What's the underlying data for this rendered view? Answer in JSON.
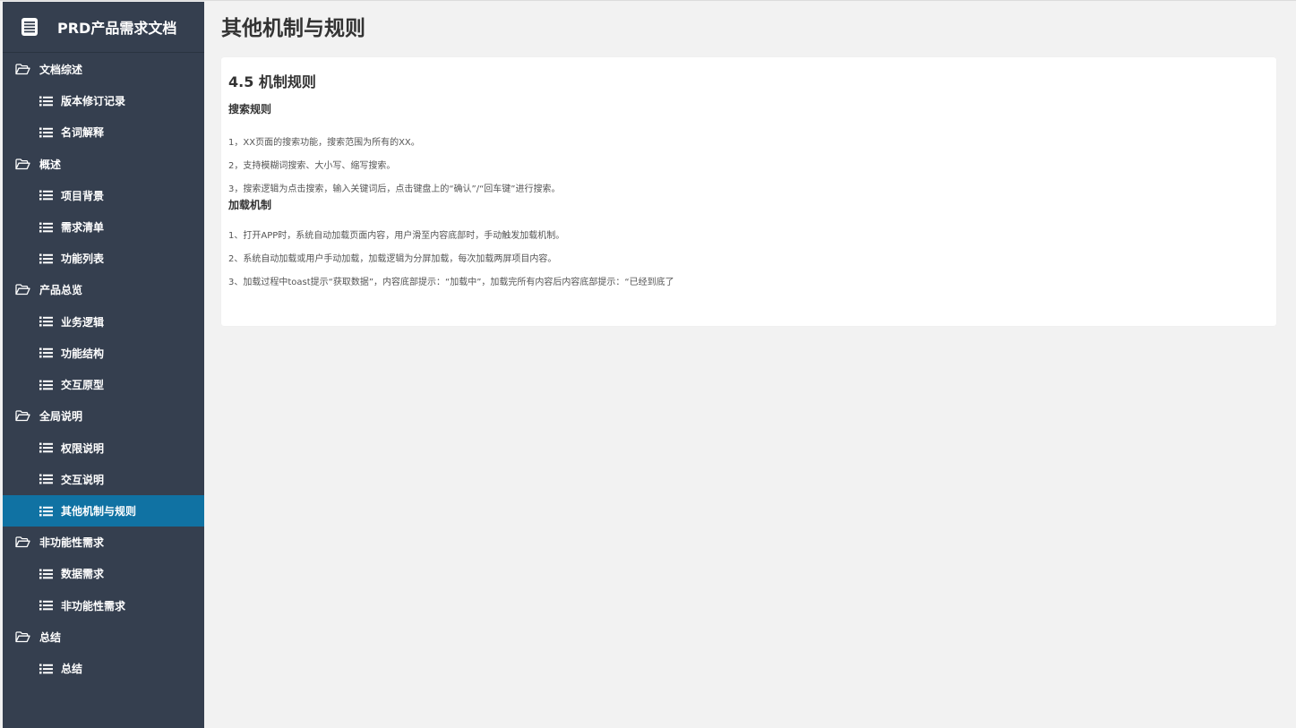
{
  "app": {
    "brand_title": "PRD产品需求文档",
    "brand_icon": "document-icon",
    "accent_color": "#1072a3",
    "sidebar_color": "#353f4f"
  },
  "sidebar": {
    "groups": [
      {
        "label": "文档综述",
        "icon": "folder-open-icon",
        "items": [
          "版本修订记录",
          "名词解释"
        ]
      },
      {
        "label": "概述",
        "icon": "folder-open-icon",
        "items": [
          "项目背景",
          "需求清单",
          "功能列表"
        ]
      },
      {
        "label": "产品总览",
        "icon": "folder-open-icon",
        "items": [
          "业务逻辑",
          "功能结构",
          "交互原型"
        ]
      },
      {
        "label": "全局说明",
        "icon": "folder-open-icon",
        "items": [
          "权限说明",
          "交互说明",
          "其他机制与规则"
        ]
      },
      {
        "label": "非功能性需求",
        "icon": "folder-open-icon",
        "items": [
          "数据需求",
          "非功能性需求"
        ]
      },
      {
        "label": "总结",
        "icon": "folder-open-icon",
        "items": [
          "总结"
        ]
      }
    ],
    "active_item": "其他机制与规则"
  },
  "page": {
    "title": "其他机制与规则"
  },
  "content": {
    "section_heading": "4.5  机制规则",
    "search": {
      "heading": "搜索规则",
      "lines": [
        "1，XX页面的搜索功能，搜索范围为所有的XX。",
        "2，支持模糊词搜索、大小写、缩写搜索。",
        "3，搜索逻辑为点击搜索，输入关键词后，点击键盘上的“确认”/“回车键”进行搜索。"
      ]
    },
    "loading": {
      "heading": "加载机制",
      "lines": [
        "1、打开APP时，系统自动加载页面内容，用户滑至内容底部时，手动触发加载机制。",
        "2、系统自动加载或用户手动加载，加载逻辑为分屏加载，每次加载两屏项目内容。",
        "3、加载过程中toast提示“获取数据”，内容底部提示：“加载中”，加载完所有内容后内容底部提示：“已经到底了"
      ]
    }
  }
}
